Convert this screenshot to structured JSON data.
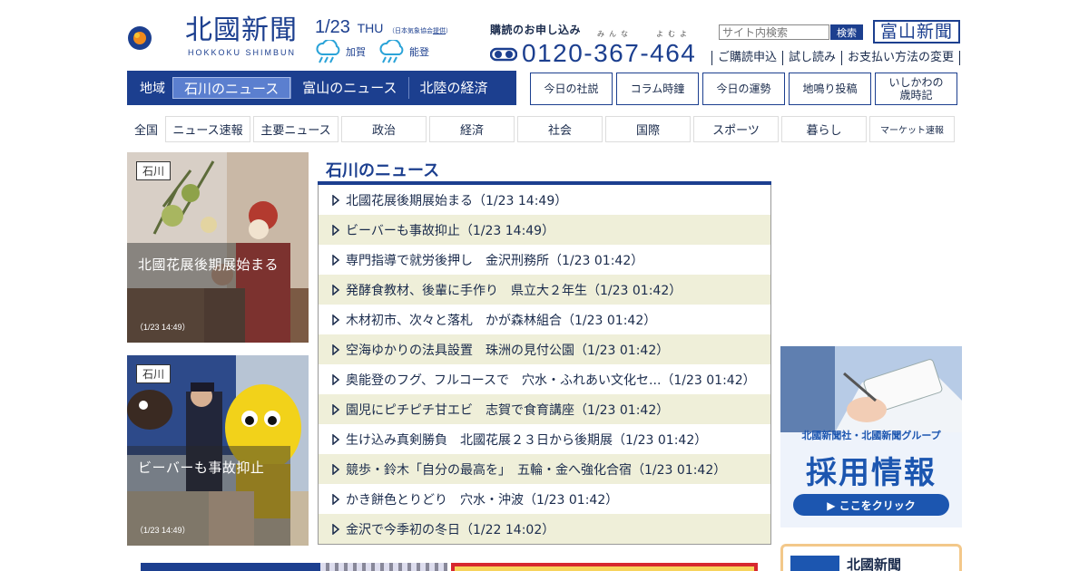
{
  "header": {
    "logo_jp": "北國新聞",
    "logo_en": "HOKKOKU SHIMBUN",
    "date": "1/23",
    "day_of_week": "THU",
    "weather_note_prefix": "（日本気象協会",
    "weather_note_link": "提供",
    "weather_note_suffix": "）",
    "weather": [
      {
        "area": "加賀",
        "icon": "cloud-rain-icon"
      },
      {
        "area": "能登",
        "icon": "cloud-rain-icon"
      }
    ],
    "subscription": {
      "title": "購読のお申し込み",
      "ruby1": "みんな",
      "ruby2": "よむよ",
      "phone": "0120-367-464",
      "icon": "free-dial-icon"
    },
    "search": {
      "placeholder": "サイト内検索",
      "button": "検索"
    },
    "toyama_link": "富山新聞",
    "util_links": [
      "ご購読申込",
      "試し読み",
      "お支払い方法の変更"
    ]
  },
  "region_nav": {
    "label": "地域",
    "tabs": [
      {
        "label": "石川のニュース",
        "active": true
      },
      {
        "label": "富山のニュース",
        "active": false
      },
      {
        "label": "北陸の経済",
        "active": false
      }
    ]
  },
  "top_buttons": [
    "今日の社説",
    "コラム時鐘",
    "今日の運勢",
    "地鳴り投稿",
    "いしかわの\n歳時記"
  ],
  "category_nav": {
    "label": "全国",
    "tabs": [
      "ニュース速報",
      "主要ニュース",
      "政治",
      "経済",
      "社会",
      "国際",
      "スポーツ",
      "暮らし",
      "マーケット速報"
    ]
  },
  "photo_cards": [
    {
      "tag": "石川",
      "title": "北國花展後期展始まる",
      "time": "（1/23 14:49）"
    },
    {
      "tag": "石川",
      "title": "ビーバーも事故抑止",
      "time": "（1/23 14:49）"
    }
  ],
  "news": {
    "heading": "石川のニュース",
    "items": [
      "北國花展後期展始まる（1/23 14:49）",
      "ビーバーも事故抑止（1/23 14:49）",
      "専門指導で就労後押し　金沢刑務所（1/23 01:42）",
      "発酵食教材、後輩に手作り　県立大２年生（1/23 01:42）",
      "木材初市、次々と落札　かが森林組合（1/23 01:42）",
      "空海ゆかりの法具設置　珠洲の見付公園（1/23 01:42）",
      "奥能登のフグ、フルコースで　穴水・ふれあい文化セ...（1/23 01:42）",
      "園児にピチピチ甘エビ　志賀で食育講座（1/23 01:42）",
      "生け込み真剣勝負　北國花展２３日から後期展（1/23 01:42）",
      "競歩・鈴木「自分の最高を」　五輪・金へ強化合宿（1/23 01:42）",
      "かき餅色とりどり　穴水・沖波（1/23 01:42）",
      "金沢で今季初の冬日（1/22 14:02）"
    ]
  },
  "recruit_banner": {
    "subtitle": "北國新聞社・北國新聞グループ",
    "title": "採用情報",
    "button": "▶ ここをクリック"
  },
  "paper_box": {
    "name": "北國新聞"
  },
  "colors": {
    "brand": "#1c3f8f",
    "active_tab": "#5b7fcf",
    "alt_row": "#efefd9",
    "recruit": "#1c56b0"
  }
}
